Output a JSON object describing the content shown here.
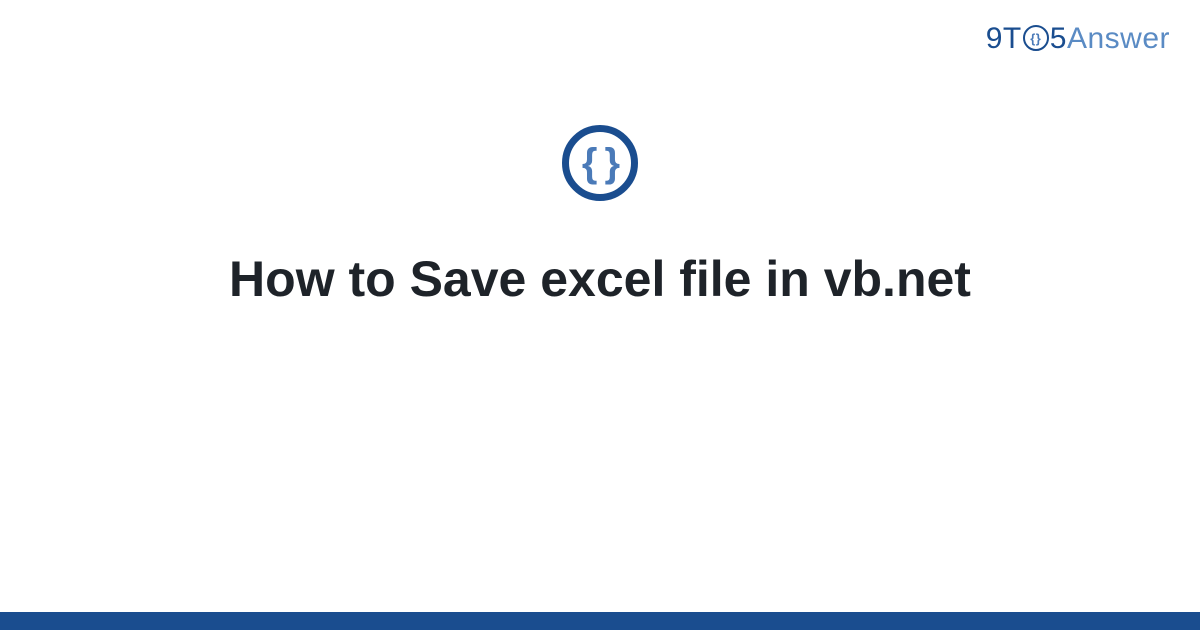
{
  "logo": {
    "part1": "9T",
    "circle_inner": "{}",
    "part2": "5",
    "part3": "Answer"
  },
  "center_icon": {
    "braces": "{ }"
  },
  "title": "How to Save excel file in vb.net",
  "colors": {
    "primary": "#1a4d8f",
    "secondary": "#4a7ab8",
    "text": "#1e2329"
  }
}
